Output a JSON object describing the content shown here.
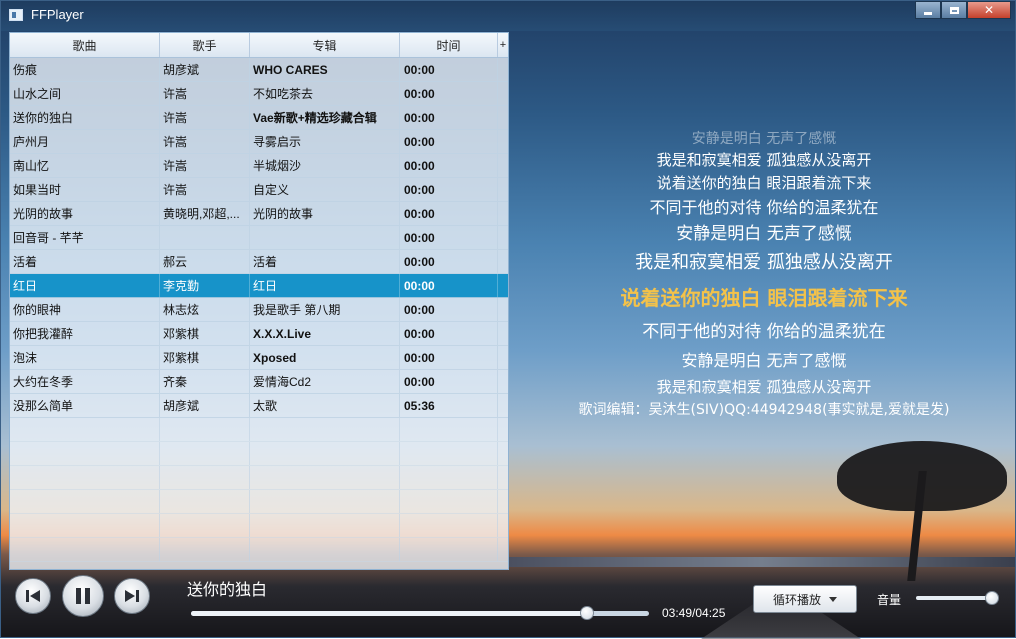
{
  "window": {
    "title": "FFPlayer"
  },
  "table": {
    "headers": [
      "歌曲",
      "歌手",
      "专辑",
      "时间"
    ],
    "rows": [
      [
        "伤痕",
        "胡彦斌",
        "WHO CARES",
        "00:00"
      ],
      [
        "山水之间",
        "许嵩",
        "不如吃茶去",
        "00:00"
      ],
      [
        "送你的独白",
        "许嵩",
        "Vae新歌+精选珍藏合辑",
        "00:00"
      ],
      [
        "庐州月",
        "许嵩",
        "寻雾启示",
        "00:00"
      ],
      [
        "南山忆",
        "许嵩",
        "半城烟沙",
        "00:00"
      ],
      [
        "如果当时",
        "许嵩",
        "自定义",
        "00:00"
      ],
      [
        "光阴的故事",
        "黄晓明,邓超,...",
        "光阴的故事",
        "00:00"
      ],
      [
        "回音哥 - 芊芊",
        "",
        "",
        "00:00"
      ],
      [
        "活着",
        "郝云",
        "活着",
        "00:00"
      ],
      [
        "红日",
        "李克勤",
        "红日",
        "00:00"
      ],
      [
        "你的眼神",
        "林志炫",
        "我是歌手 第八期",
        "00:00"
      ],
      [
        "你把我灌醉",
        "邓紫棋",
        "X.X.X.Live",
        "00:00"
      ],
      [
        "泡沫",
        "邓紫棋",
        "Xposed",
        "00:00"
      ],
      [
        "大约在冬季",
        "齐秦",
        "爱情海Cd2",
        "00:00"
      ],
      [
        "没那么简单",
        "胡彦斌",
        "太歌",
        "05:36"
      ]
    ],
    "selected_index": 9
  },
  "lyrics": [
    {
      "text": "安静是明白 无声了感慨",
      "style": "faded"
    },
    {
      "text": "我是和寂寞相爱 孤独感从没离开",
      "style": "normal"
    },
    {
      "text": "说着送你的独白 眼泪跟着流下来",
      "style": "normal"
    },
    {
      "text": "不同于他的对待 你给的温柔犹在",
      "style": "normal"
    },
    {
      "text": "安静是明白 无声了感慨",
      "style": "normal"
    },
    {
      "text": "我是和寂寞相爱 孤独感从没离开",
      "style": "normal"
    },
    {
      "text": "说着送你的独白 眼泪跟着流下来",
      "style": "current"
    },
    {
      "text": "不同于他的对待 你给的温柔犹在",
      "style": "normal"
    },
    {
      "text": "安静是明白 无声了感慨",
      "style": "normal"
    },
    {
      "text": "我是和寂寞相爱 孤独感从没离开",
      "style": "normal"
    },
    {
      "text": "歌词编辑：吴沐生(SIV)QQ:44942948(事实就是,爱就是发)",
      "style": "credit"
    }
  ],
  "player": {
    "now_playing": "送你的独白",
    "time": "03:49/04:25",
    "progress": 0.864,
    "mode_label": "循环播放",
    "volume_label": "音量",
    "volume": 0.95
  },
  "colors": {
    "selection": "#1793c9",
    "current_lyric": "#f3c24a"
  }
}
